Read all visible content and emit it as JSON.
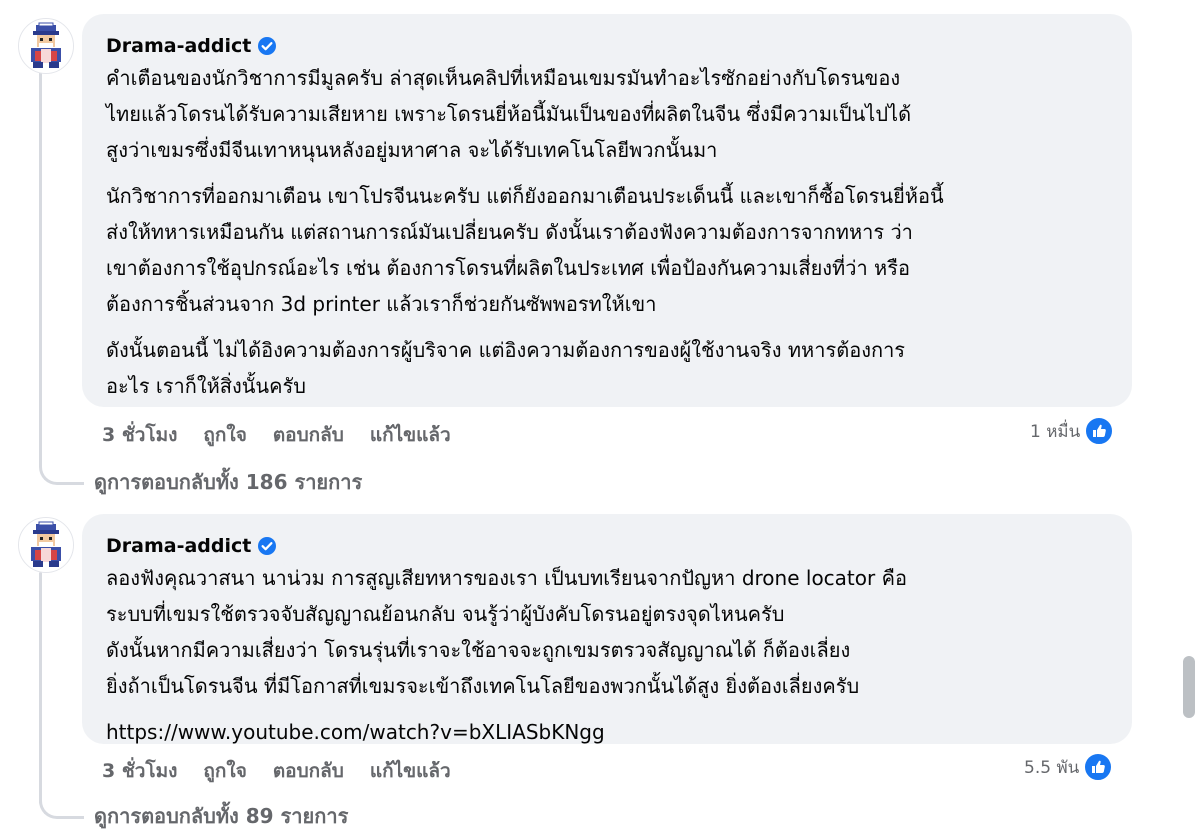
{
  "comments": [
    {
      "author": "Drama-addict",
      "paragraphs": [
        "คำเตือนของนักวิชาการมีมูลครับ ล่าสุดเห็นคลิปที่เหมือนเขมรมันทำอะไรซักอย่างกับโดรนของ\nไทยแล้วโดรนได้รับความเสียหาย เพราะโดรนยี่ห้อนี้มันเป็นของที่ผลิตในจีน ซึ่งมีความเป็นไปได้\nสูงว่าเขมรซึ่งมีจีนเทาหนุนหลังอยู่มหาศาล จะได้รับเทคโนโลยีพวกนั้นมา",
        "นักวิชาการที่ออกมาเตือน เขาโปรจีนนะครับ แต่ก็ยังออกมาเตือนประเด็นนี้ และเขาก็ซื้อโดรนยี่ห้อนี้\nส่งให้ทหารเหมือนกัน แต่สถานการณ์มันเปลี่ยนครับ ดังนั้นเราต้องฟังความต้องการจากทหาร ว่า\nเขาต้องการใช้อุปกรณ์อะไร เช่น ต้องการโดรนที่ผลิตในประเทศ เพื่อป้องกันความเสี่ยงที่ว่า หรือ\nต้องการชิ้นส่วนจาก 3d printer แล้วเราก็ช่วยกันซัพพอรทให้เขา",
        "ดังนั้นตอนนี้ ไม่ได้อิงความต้องการผู้บริจาค แต่อิงความต้องการของผู้ใช้งานจริง ทหารต้องการ\nอะไร เราก็ให้สิ่งนั้นครับ"
      ],
      "link": "",
      "time": "3 ชั่วโมง",
      "like_label": "ถูกใจ",
      "reply_label": "ตอบกลับ",
      "edited_label": "แก้ไขแล้ว",
      "reaction_count": "1 หมื่น",
      "view_replies": "ดูการตอบกลับทั้ง 186 รายการ"
    },
    {
      "author": "Drama-addict",
      "paragraphs": [
        "ลองฟังคุณวาสนา นาน่วม การสูญเสียทหารของเรา เป็นบทเรียนจากปัญหา drone locator คือ\nระบบที่เขมรใช้ตรวจจับสัญญาณย้อนกลับ จนรู้ว่าผู้บังคับโดรนอยู่ตรงจุดไหนครับ\nดังนั้นหากมีความเสี่ยงว่า โดรนรุ่นที่เราจะใช้อาจจะถูกเขมรตรวจสัญญาณได้ ก็ต้องเลี่ยง\nยิ่งถ้าเป็นโดรนจีน ที่มีโอกาสที่เขมรจะเข้าถึงเทคโนโลยีของพวกนั้นได้สูง ยิ่งต้องเลี่ยงครับ"
      ],
      "link": "https://www.youtube.com/watch?v=bXLIASbKNgg",
      "time": "3 ชั่วโมง",
      "like_label": "ถูกใจ",
      "reply_label": "ตอบกลับ",
      "edited_label": "แก้ไขแล้ว",
      "reaction_count": "5.5 พัน",
      "view_replies": "ดูการตอบกลับทั้ง 89 รายการ"
    }
  ],
  "colors": {
    "bubble": "#f0f2f5",
    "secondary_text": "#65676b",
    "like_blue": "#1877f2",
    "verified_blue": "#1877f2"
  },
  "icons": {
    "verified": "verified-badge-icon",
    "reaction": "like-thumb-icon",
    "avatar": "pixel-art-avatar"
  }
}
